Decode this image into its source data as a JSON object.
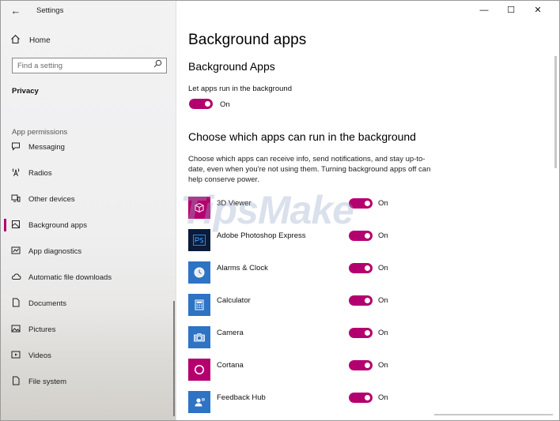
{
  "window": {
    "title": "Settings",
    "controls": {
      "minimize": "—",
      "maximize": "☐",
      "close": "✕"
    }
  },
  "sidebar": {
    "back_glyph": "←",
    "home_label": "Home",
    "search_placeholder": "Find a setting",
    "section_title": "Privacy",
    "group_label": "App permissions",
    "items": [
      {
        "label": "Messaging",
        "icon": "message-icon"
      },
      {
        "label": "Radios",
        "icon": "radio-tower-icon"
      },
      {
        "label": "Other devices",
        "icon": "devices-icon"
      },
      {
        "label": "Background apps",
        "icon": "background-apps-icon",
        "active": true
      },
      {
        "label": "App diagnostics",
        "icon": "chart-icon"
      },
      {
        "label": "Automatic file downloads",
        "icon": "cloud-icon"
      },
      {
        "label": "Documents",
        "icon": "document-icon"
      },
      {
        "label": "Pictures",
        "icon": "picture-icon"
      },
      {
        "label": "Videos",
        "icon": "video-icon"
      },
      {
        "label": "File system",
        "icon": "file-icon"
      }
    ]
  },
  "main": {
    "page_title": "Background apps",
    "section1_title": "Background Apps",
    "let_apps_label": "Let apps run in the background",
    "master_toggle_text": "On",
    "section2_title": "Choose which apps can run in the background",
    "description": "Choose which apps can receive info, send notifications, and stay up-to-date, even when you're not using them. Turning background apps off can help conserve power.",
    "apps": [
      {
        "name": "3D Viewer",
        "state": "On",
        "tile_color": "#b4006e",
        "icon": "cube-icon"
      },
      {
        "name": "Adobe Photoshop Express",
        "state": "On",
        "tile_color": "#0b1b3a",
        "icon": "photoshop-icon"
      },
      {
        "name": "Alarms & Clock",
        "state": "On",
        "tile_color": "#2e73c4",
        "icon": "clock-icon"
      },
      {
        "name": "Calculator",
        "state": "On",
        "tile_color": "#2e73c4",
        "icon": "calculator-icon"
      },
      {
        "name": "Camera",
        "state": "On",
        "tile_color": "#2e73c4",
        "icon": "camera-icon"
      },
      {
        "name": "Cortana",
        "state": "On",
        "tile_color": "#b4006e",
        "icon": "cortana-icon"
      },
      {
        "name": "Feedback Hub",
        "state": "On",
        "tile_color": "#2e73c4",
        "icon": "feedback-icon"
      }
    ]
  },
  "watermark": "TipsMake",
  "colors": {
    "accent": "#b4006e",
    "tile_blue": "#2e73c4"
  }
}
